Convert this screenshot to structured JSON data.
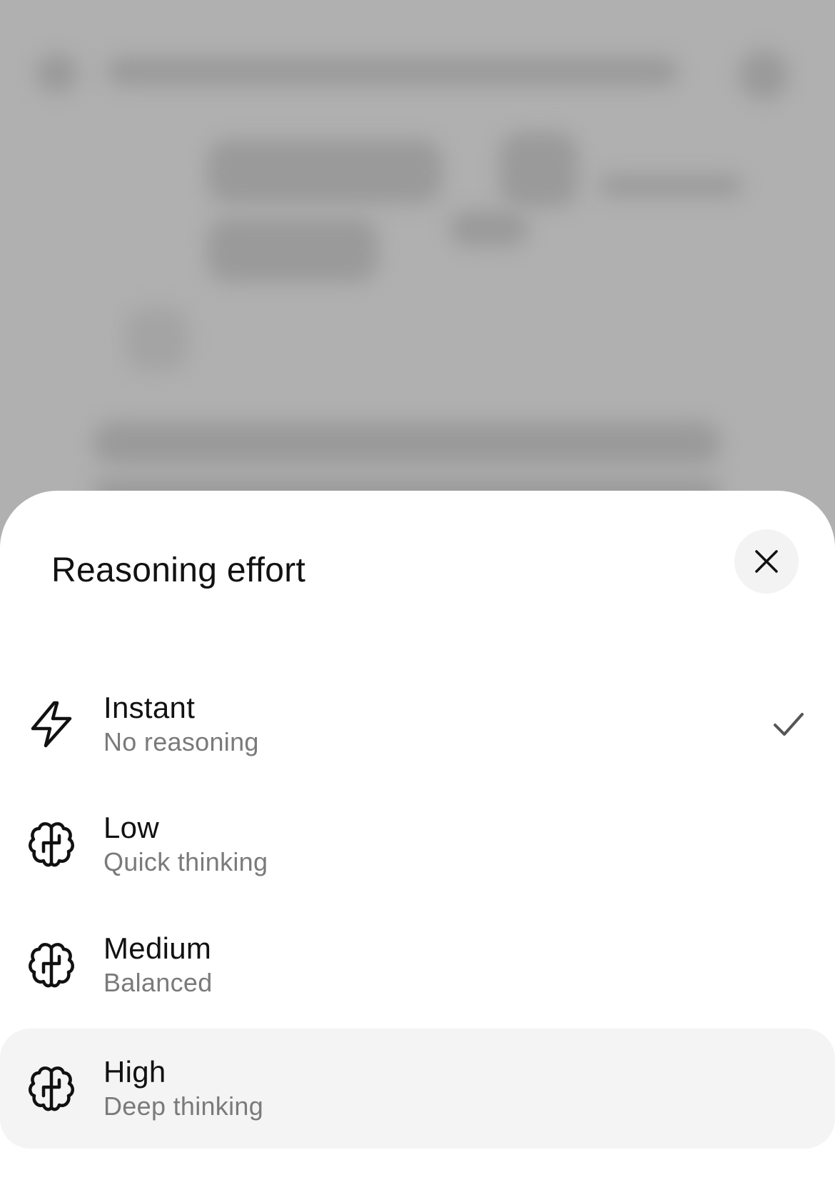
{
  "sheet": {
    "title": "Reasoning effort",
    "close_icon": "close-icon"
  },
  "options": [
    {
      "label": "Instant",
      "description": "No reasoning",
      "icon": "lightning-icon",
      "selected": true,
      "highlighted": false
    },
    {
      "label": "Low",
      "description": "Quick thinking",
      "icon": "brain-icon",
      "selected": false,
      "highlighted": false
    },
    {
      "label": "Medium",
      "description": "Balanced",
      "icon": "brain-icon",
      "selected": false,
      "highlighted": false
    },
    {
      "label": "High",
      "description": "Deep thinking",
      "icon": "brain-icon",
      "selected": false,
      "highlighted": true
    }
  ],
  "colors": {
    "sheet_background": "#ffffff",
    "backdrop": "#b0b0b0",
    "title_text": "#111111",
    "secondary_text": "#7a7a7a",
    "highlight_row": "#f4f4f4",
    "close_button_bg": "#f3f3f3",
    "check": "#555555"
  }
}
